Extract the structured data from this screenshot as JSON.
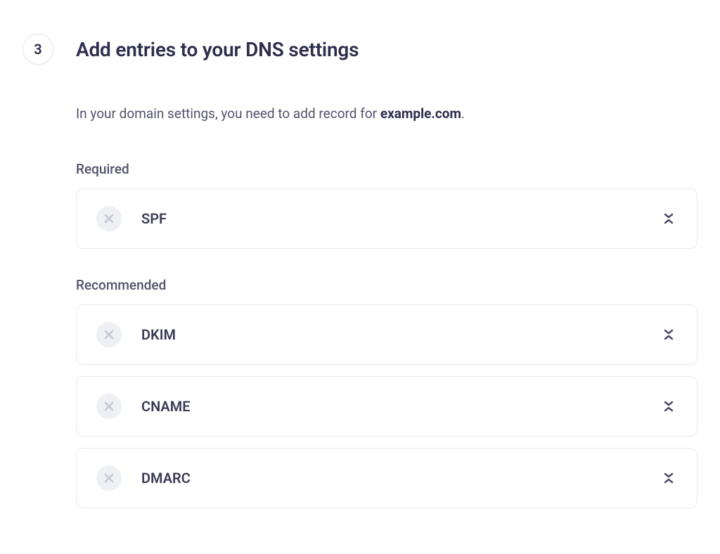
{
  "step": {
    "number": "3",
    "title": "Add entries to your DNS settings"
  },
  "intro": {
    "prefix": "In your domain settings, you need to add record for ",
    "domain": "example.com",
    "suffix": "."
  },
  "sections": {
    "required": {
      "label": "Required",
      "records": [
        {
          "name": "SPF"
        }
      ]
    },
    "recommended": {
      "label": "Recommended",
      "records": [
        {
          "name": "DKIM"
        },
        {
          "name": "CNAME"
        },
        {
          "name": "DMARC"
        }
      ]
    }
  }
}
